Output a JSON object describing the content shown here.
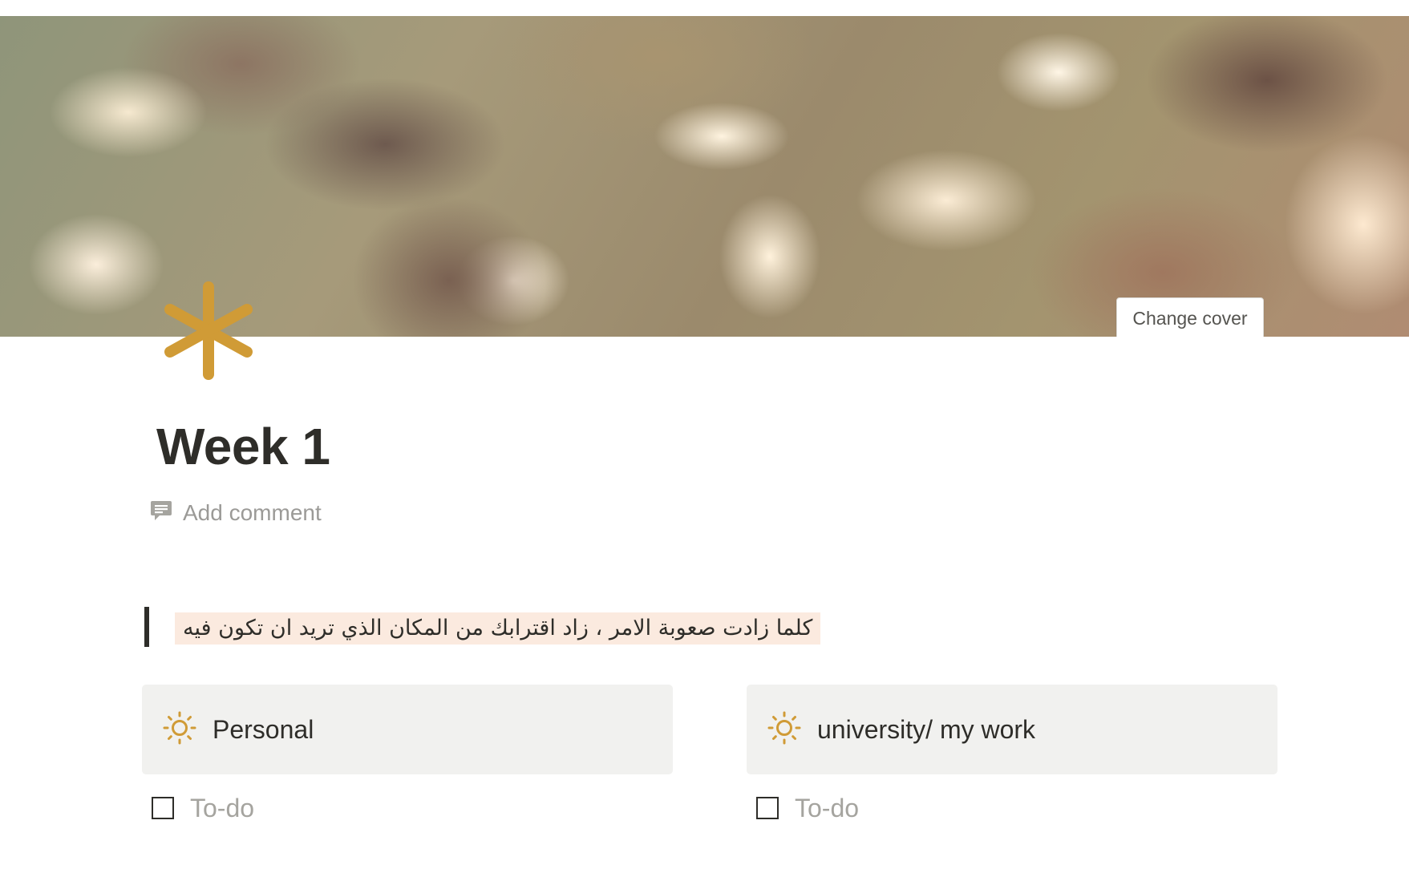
{
  "cover": {
    "change_cover_label": "Change cover"
  },
  "page": {
    "icon": "asterisk-icon",
    "icon_color": "#d09b36",
    "title": "Week 1",
    "add_comment_label": "Add comment"
  },
  "quote": {
    "text": "كلما زادت صعوبة الامر ، زاد اقترابك من المكان الذي تريد ان تكون فيه",
    "highlight_color": "#fbeadf"
  },
  "columns": [
    {
      "callout": {
        "icon": "sun-icon",
        "label": "Personal"
      },
      "todo": {
        "checked": false,
        "placeholder": "To-do"
      }
    },
    {
      "callout": {
        "icon": "sun-icon",
        "label": "university/ my work"
      },
      "todo": {
        "checked": false,
        "placeholder": "To-do"
      }
    }
  ]
}
